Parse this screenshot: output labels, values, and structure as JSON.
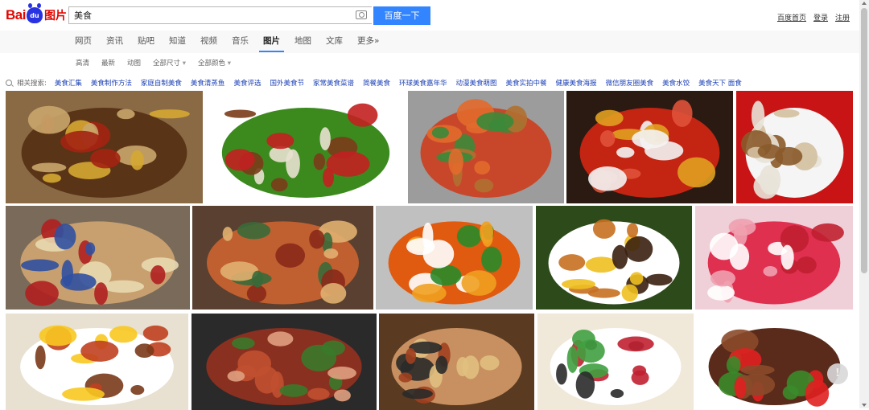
{
  "logo": {
    "text_left": "Bai",
    "text_paw": "du",
    "text_right": "图片"
  },
  "search": {
    "query": "美食",
    "button_label": "百度一下"
  },
  "top_links": [
    "百度首页",
    "登录",
    "注册"
  ],
  "nav_tabs": [
    "网页",
    "资讯",
    "贴吧",
    "知道",
    "视频",
    "音乐",
    "图片",
    "地图",
    "文库",
    "更多»"
  ],
  "nav_active": "图片",
  "filters": [
    "高清",
    "最新",
    "动图",
    "全部尺寸",
    "全部颜色"
  ],
  "related": {
    "label": "相关搜索:",
    "terms": [
      "美食汇集",
      "美食制作方法",
      "家庭自制美食",
      "美食清蒸鱼",
      "美食评选",
      "国外美食节",
      "家常美食菜谱",
      "简餐美食",
      "环球美食嘉年华",
      "动漫美食萌图",
      "美食实拍中餐",
      "健康美食海报",
      "微信朋友圈美食",
      "美食水饺",
      "美食天下 面食"
    ]
  },
  "images": [
    {
      "id": "grilled-chicken-wings",
      "icon": "food-photo"
    },
    {
      "id": "beef-kebab-skewers",
      "icon": "food-photo"
    },
    {
      "id": "spicy-crayfish-plate",
      "icon": "food-photo"
    },
    {
      "id": "red-lobster-platter",
      "icon": "food-photo"
    },
    {
      "id": "noodle-dumpling-plate",
      "icon": "food-photo"
    },
    {
      "id": "hotdog-burger-spread",
      "icon": "food-photo"
    },
    {
      "id": "food-collage-grid",
      "icon": "food-photo"
    },
    {
      "id": "carved-dragon-dish",
      "icon": "food-photo"
    },
    {
      "id": "fried-egg-rice-plate",
      "icon": "food-photo"
    },
    {
      "id": "strawberry-cupcakes",
      "icon": "food-photo"
    },
    {
      "id": "anime-breakfast-plate",
      "icon": "food-photo"
    },
    {
      "id": "steak-meat-collage",
      "icon": "food-photo"
    },
    {
      "id": "hotpot-table-spread",
      "icon": "food-photo"
    },
    {
      "id": "sushi-plate",
      "icon": "food-photo"
    },
    {
      "id": "grilled-steak-tomato",
      "icon": "food-photo"
    }
  ],
  "feedback_icon": "!",
  "colors": {
    "brand_red": "#e10601",
    "brand_blue": "#2932e1",
    "button_blue": "#3385ff",
    "link_blue": "#1a3fb6"
  }
}
